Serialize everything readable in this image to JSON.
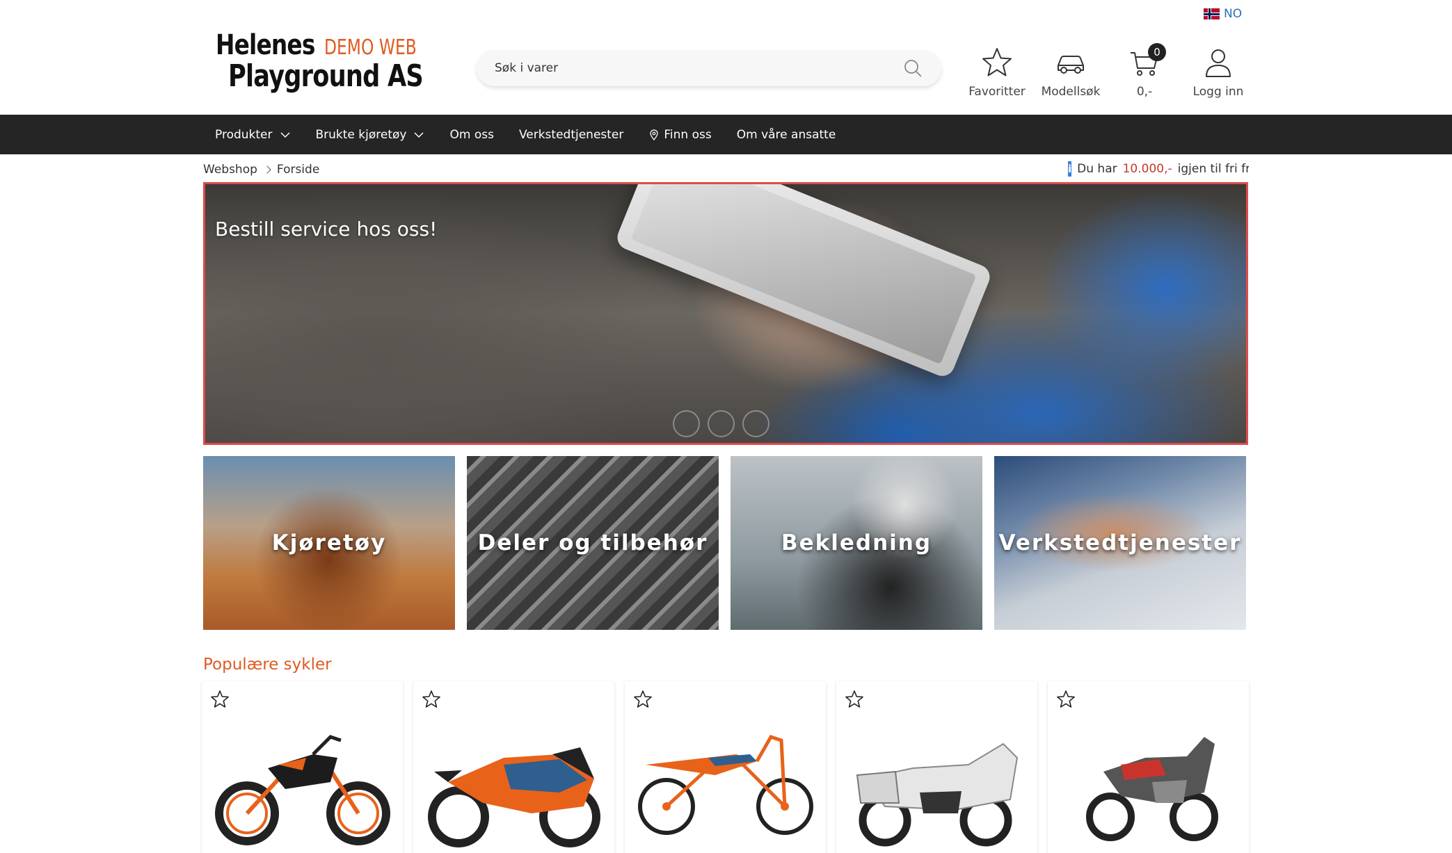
{
  "topbar": {
    "language": "NO"
  },
  "header": {
    "logo": {
      "line1": "Helenes",
      "tag": "DEMO WEB",
      "line2": "Playground AS"
    },
    "search": {
      "placeholder": "Søk i varer"
    },
    "icons": [
      {
        "name": "favorites",
        "label": "Favoritter"
      },
      {
        "name": "model-search",
        "label": "Modellsøk"
      },
      {
        "name": "cart",
        "label": "0,-",
        "badge": "0"
      },
      {
        "name": "login",
        "label": "Logg inn"
      }
    ]
  },
  "nav": {
    "items": [
      {
        "label": "Produkter",
        "dropdown": true
      },
      {
        "label": "Brukte kjøretøy",
        "dropdown": true
      },
      {
        "label": "Om oss"
      },
      {
        "label": "Verkstedtjenester"
      },
      {
        "label": "Finn oss",
        "icon": "map-pin"
      },
      {
        "label": "Om våre ansatte"
      }
    ]
  },
  "breadcrumb": {
    "root": "Webshop",
    "current": "Forside"
  },
  "notice": {
    "prefix": "Du har",
    "amount": "10.000,-",
    "suffix": "igjen til fri frakt"
  },
  "hero": {
    "title": "Bestill service hos oss!",
    "slides": 3
  },
  "categories": [
    {
      "label": "Kjøretøy"
    },
    {
      "label": "Deler og tilbehør"
    },
    {
      "label": "Bekledning"
    },
    {
      "label": "Verkstedtjenester"
    }
  ],
  "popular": {
    "title": "Populære sykler",
    "count": 5
  },
  "colors": {
    "accent": "#e05a1f",
    "nav_bg": "#252525",
    "link": "#2a6ebb",
    "hero_border": "#e04a4a"
  }
}
